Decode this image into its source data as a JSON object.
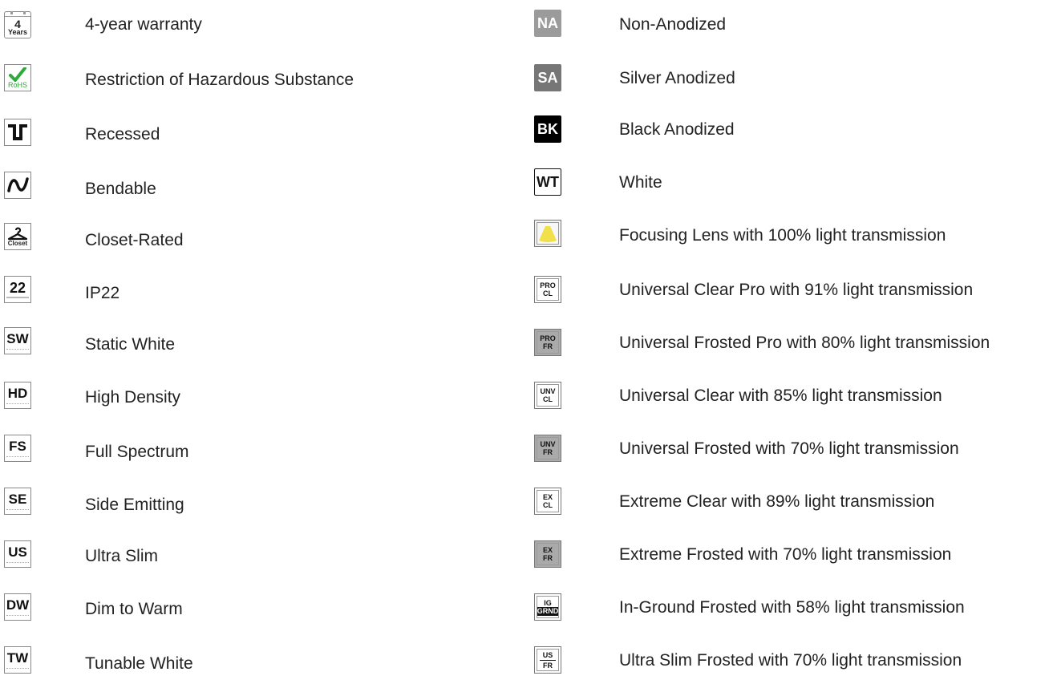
{
  "left_items": [
    {
      "icon": "warranty-4-years-icon",
      "icon_text_top": "4",
      "icon_text_bottom": "Years",
      "label": "4-year warranty"
    },
    {
      "icon": "rohs-check-icon",
      "icon_text": "RoHS",
      "label": "Restriction of Hazardous Substance"
    },
    {
      "icon": "recessed-icon",
      "label": "Recessed"
    },
    {
      "icon": "bendable-wave-icon",
      "label": "Bendable"
    },
    {
      "icon": "closet-hanger-icon",
      "icon_text": "Closet",
      "label": "Closet-Rated"
    },
    {
      "icon": "ip22-icon",
      "icon_text": "22",
      "label": "IP22"
    },
    {
      "icon": "static-white-icon",
      "icon_text": "SW",
      "label": "Static White"
    },
    {
      "icon": "high-density-icon",
      "icon_text": "HD",
      "label": "High Density"
    },
    {
      "icon": "full-spectrum-icon",
      "icon_text": "FS",
      "label": "Full Spectrum"
    },
    {
      "icon": "side-emitting-icon",
      "icon_text": "SE",
      "label": "Side Emitting"
    },
    {
      "icon": "ultra-slim-icon",
      "icon_text": "US",
      "label": "Ultra Slim"
    },
    {
      "icon": "dim-to-warm-icon",
      "icon_text": "DW",
      "label": "Dim to Warm"
    },
    {
      "icon": "tunable-white-icon",
      "icon_text": "TW",
      "label": "Tunable White"
    }
  ],
  "right_items": [
    {
      "icon": "non-anodized-icon",
      "icon_text": "NA",
      "label": "Non-Anodized",
      "color": "#9b9b9b"
    },
    {
      "icon": "silver-anodized-icon",
      "icon_text": "SA",
      "label": "Silver Anodized",
      "color": "#767676"
    },
    {
      "icon": "black-anodized-icon",
      "icon_text": "BK",
      "label": "Black Anodized",
      "color": "#000000"
    },
    {
      "icon": "white-icon",
      "icon_text": "WT",
      "label": "White",
      "color": "#ffffff"
    },
    {
      "icon": "focusing-lens-icon",
      "label": "Focusing Lens with 100% light transmission",
      "color": "#f2e04a"
    },
    {
      "icon": "universal-clear-pro-icon",
      "icon_text_top": "PRO",
      "icon_text_bottom": "CL",
      "label": "Universal Clear Pro with 91% light transmission"
    },
    {
      "icon": "universal-frosted-pro-icon",
      "icon_text_top": "PRO",
      "icon_text_bottom": "FR",
      "label": "Universal Frosted Pro with 80% light transmission"
    },
    {
      "icon": "universal-clear-icon",
      "icon_text_top": "UNV",
      "icon_text_bottom": "CL",
      "label": "Universal Clear with 85% light transmission"
    },
    {
      "icon": "universal-frosted-icon",
      "icon_text_top": "UNV",
      "icon_text_bottom": "FR",
      "label": "Universal Frosted with 70% light transmission"
    },
    {
      "icon": "extreme-clear-icon",
      "icon_text_top": "EX",
      "icon_text_bottom": "CL",
      "label": "Extreme Clear with 89% light transmission"
    },
    {
      "icon": "extreme-frosted-icon",
      "icon_text_top": "EX",
      "icon_text_bottom": "FR",
      "label": "Extreme Frosted with 70% light transmission"
    },
    {
      "icon": "in-ground-frosted-icon",
      "icon_text_top": "IG",
      "icon_text_bottom": "GRND",
      "label": "In-Ground Frosted with 58% light transmission"
    },
    {
      "icon": "ultra-slim-frosted-icon",
      "icon_text_top": "US",
      "icon_text_bottom": "FR",
      "label": "Ultra Slim Frosted with 70% light transmission"
    }
  ]
}
